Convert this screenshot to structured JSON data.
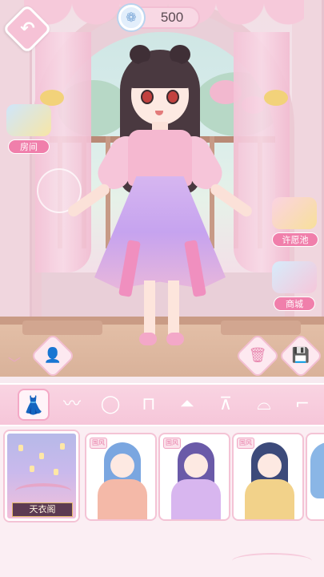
{
  "hud": {
    "coins": "500",
    "back_icon": "back-arrow-icon",
    "coin_icon": "diamond-coin-icon"
  },
  "side_buttons": {
    "room_label": "房间",
    "wish_pool_label": "许愿池",
    "shop_label": "商城"
  },
  "tools": {
    "profile_icon": "person-icon",
    "delete_icon": "trash-icon",
    "save_icon": "save-icon",
    "collapse_icon": "chevron-down-icon"
  },
  "categories": [
    {
      "icon": "dress-full-icon",
      "glyph": "👗",
      "active": true
    },
    {
      "icon": "hair-icon",
      "glyph": "〰",
      "active": false
    },
    {
      "icon": "face-icon",
      "glyph": "◯",
      "active": false
    },
    {
      "icon": "top-icon",
      "glyph": "⊓",
      "active": false
    },
    {
      "icon": "skirt-icon",
      "glyph": "⏶",
      "active": false
    },
    {
      "icon": "coat-icon",
      "glyph": "⊼",
      "active": false
    },
    {
      "icon": "shoes-icon",
      "glyph": "⌓",
      "active": false
    },
    {
      "icon": "socks-icon",
      "glyph": "⌐",
      "active": false
    }
  ],
  "featured": {
    "banner": "天衣阁"
  },
  "items": [
    {
      "tag": "国风",
      "hair_color": "#7aa6e0",
      "body_color": "#f4b9a8"
    },
    {
      "tag": "国风",
      "hair_color": "#6a5aa8",
      "body_color": "#d8b6ef"
    },
    {
      "tag": "国风",
      "hair_color": "#3c4a7a",
      "body_color": "#f2d28a"
    },
    {
      "tag": "",
      "hair_color": "#8ab6e6",
      "body_color": "#f4c3d5"
    }
  ],
  "colors": {
    "accent_pink": "#f07fab",
    "cat_bar": "#f6c6d9"
  }
}
